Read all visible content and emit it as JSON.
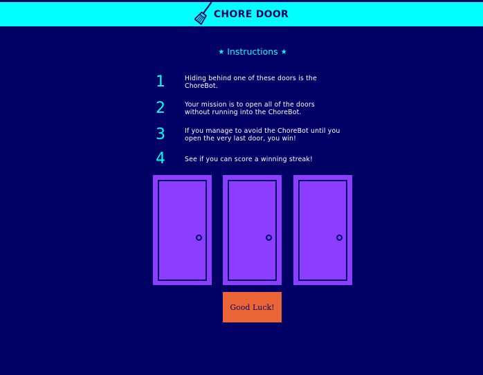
{
  "header": {
    "title": "CHORE DOOR",
    "logo_icon": "broom-icon",
    "background_color": "#00ffff"
  },
  "instructions": {
    "title": "Instructions",
    "star_icon": "★",
    "items": [
      {
        "number": "1",
        "text": "Hiding behind one of these doors is the ChoreBot."
      },
      {
        "number": "2",
        "text": "Your mission is to open all of the doors without running into the ChoreBot."
      },
      {
        "number": "3",
        "text": "If you manage to avoid the ChoreBot until you open the very last door, you win!"
      },
      {
        "number": "4",
        "text": "See if you can score a winning streak!"
      }
    ]
  },
  "doors": {
    "count": 3,
    "color": "#8c3dff"
  },
  "start_button": {
    "label": "Good Luck!",
    "color": "#eb6536"
  },
  "colors": {
    "background": "#010165",
    "accent": "#00ffff",
    "text": "#ffffff"
  }
}
